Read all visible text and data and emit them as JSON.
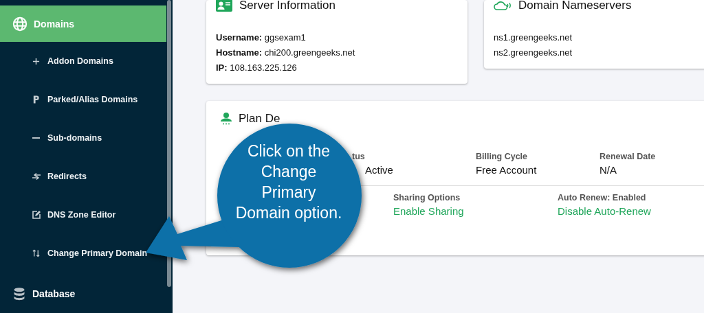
{
  "sidebar": {
    "sections": [
      {
        "label": "Domains",
        "selected": true,
        "children": [
          {
            "label": "Addon Domains"
          },
          {
            "label": "Parked/Alias Domains"
          },
          {
            "label": "Sub-domains"
          },
          {
            "label": "Redirects"
          },
          {
            "label": "DNS Zone Editor"
          },
          {
            "label": "Change Primary Domain"
          }
        ]
      },
      {
        "label": "Database",
        "selected": false
      }
    ]
  },
  "server_information": {
    "title": "Server Information",
    "fields": [
      {
        "label": "Username:",
        "value": "ggsexam1"
      },
      {
        "label": "Hostname:",
        "value": "chi200.greengeeks.net"
      },
      {
        "label": "IP:",
        "value": "108.163.225.126"
      }
    ]
  },
  "domain_nameservers": {
    "title": "Domain Nameservers",
    "servers": [
      "ns1.greengeeks.net",
      "ns2.greengeeks.net"
    ]
  },
  "plan_details": {
    "title": "Plan De",
    "row_1": [
      {
        "label": "tus",
        "value": "Active"
      },
      {
        "label": "Billing Cycle",
        "value": "Free Account"
      },
      {
        "label": "Renewal Date",
        "value": "N/A"
      }
    ],
    "row_2": [
      {
        "label": "Sharing Options",
        "link": "Enable Sharing"
      },
      {
        "label": "Auto Renew: Enabled",
        "link": "Disable Auto-Renew"
      }
    ]
  },
  "callout": {
    "text": "Click on the Change Primary Domain option."
  }
}
